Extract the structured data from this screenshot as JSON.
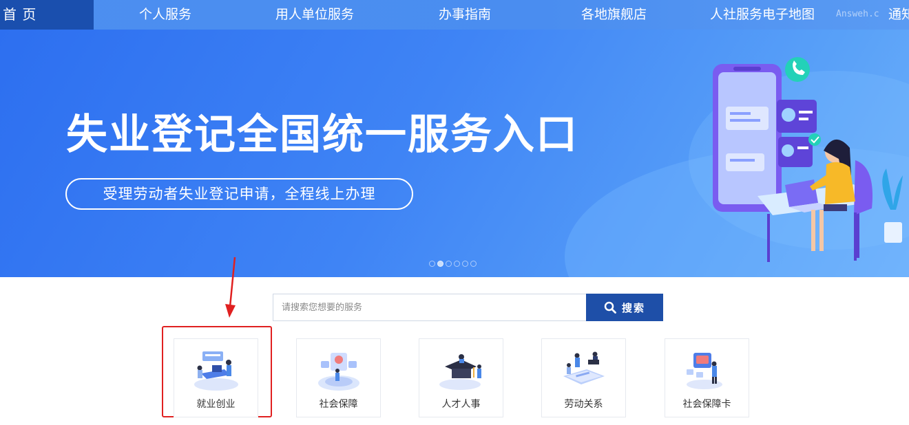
{
  "nav": {
    "home": "首 页",
    "items": [
      "个人服务",
      "用人单位服务",
      "办事指南",
      "各地旗舰店",
      "人社服务电子地图",
      "通知"
    ],
    "watermark": "Answeh.c"
  },
  "banner": {
    "title": "失业登记全国统一服务入口",
    "subtitle": "受理劳动者失业登记申请，全程线上办理",
    "carousel": {
      "count": 6,
      "active_index": 1
    }
  },
  "search": {
    "placeholder": "请搜索您想要的服务",
    "button_label": "搜索"
  },
  "services": [
    {
      "label": "就业创业",
      "icon": "employment-icon"
    },
    {
      "label": "社会保障",
      "icon": "social-security-icon"
    },
    {
      "label": "人才人事",
      "icon": "talent-icon"
    },
    {
      "label": "劳动关系",
      "icon": "labor-relations-icon"
    },
    {
      "label": "社会保障卡",
      "icon": "social-security-card-icon"
    }
  ],
  "colors": {
    "nav_active": "#1a4fae",
    "banner_start": "#2d6ff0",
    "search_button": "#1e4fa8",
    "highlight": "#e02020"
  }
}
